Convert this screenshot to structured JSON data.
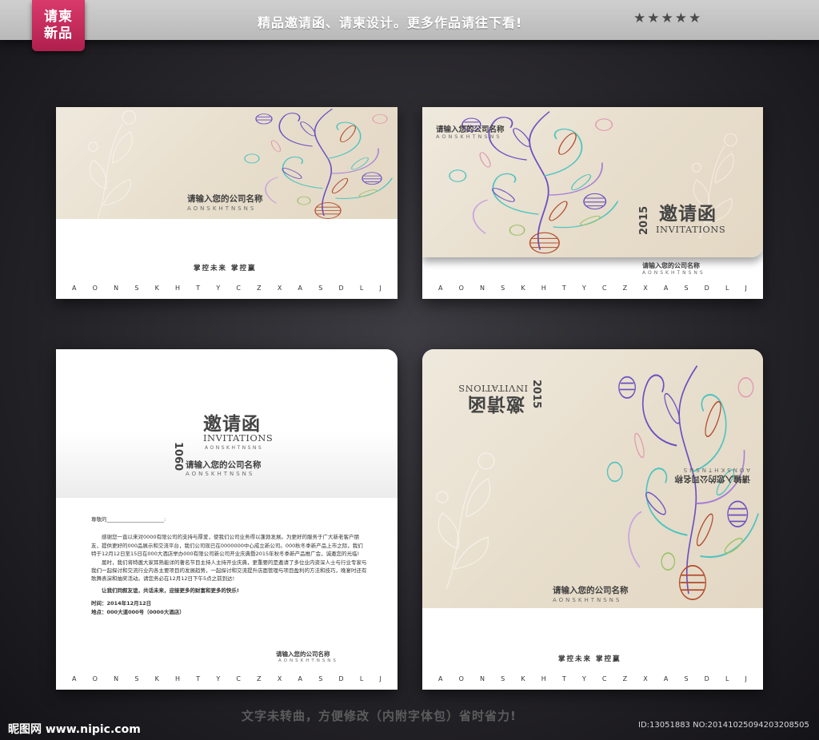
{
  "banner": {
    "badge_line1": "请柬",
    "badge_line2": "新品",
    "slogan": "精品邀请函、请柬设计。更多作品请往下看!",
    "stars": "★★★★★"
  },
  "company": {
    "name": "请输入您的公司名称",
    "name_en": "AONSKHTNSNS",
    "slogan": "掌控未来  掌控赢"
  },
  "letters": [
    "A",
    "O",
    "N",
    "S",
    "K",
    "H",
    "T",
    "Y",
    "C",
    "Z",
    "X",
    "A",
    "S",
    "D",
    "L",
    "J"
  ],
  "title": {
    "zh": "邀请函",
    "en": "INVITATIONS",
    "en_sub": "AONSKHTNSNS",
    "year": "2015",
    "year_card3": "1060"
  },
  "letter": {
    "salutation": "尊敬的______________________:",
    "para1": "感谢您一直以来对0000有限公司的支持与厚爱，使我们公司业务得以蓬勃发展。为更好的服务于广大新老客户朋友，提供更好的000品展示和交流平台，我们公司现已在0000000中心成立新公司。000秋冬季新产品上市之际，我们特于12月12日至15日在000大酒店举办000有限公司新公司开业庆典暨2015年秋冬季新产品推广会，诚邀您的光临!",
    "para2": "届时，我们将特邀大家耳熟能详的著名节目主持人主持开业庆典，更重要的是邀请了多位业内资深人士与行业专家与我们一起探讨和交流行业内各主要项目的发展趋势，一起探讨和交流提升店面管理与项目盈利的方法和技巧，晚宴时还有歌舞表演和抽奖活动。请您务必在12月12日下午5点之前到达!",
    "para3": "让我们同叙友谊，共话未来，迎接更多的财富和更多的快乐!",
    "time": "时间：2014年12月12日",
    "place": "地点：000大道000号（0000大酒店）"
  },
  "footer": {
    "site": "昵图网 www.nipic.com",
    "slogan": "文字未转曲，方便修改（内附字体包）省时省力!",
    "id": "ID:13051883 NO:20141025094203208505"
  },
  "colors": {
    "banner": "#c4c4c4",
    "badge": "#c72a5a",
    "background": "#2b2a2f",
    "card_beige": "#e9dfcd",
    "flourish_teal": "#4fc4c0",
    "flourish_purple": "#6a4fc2",
    "flourish_red": "#b24a2c"
  }
}
